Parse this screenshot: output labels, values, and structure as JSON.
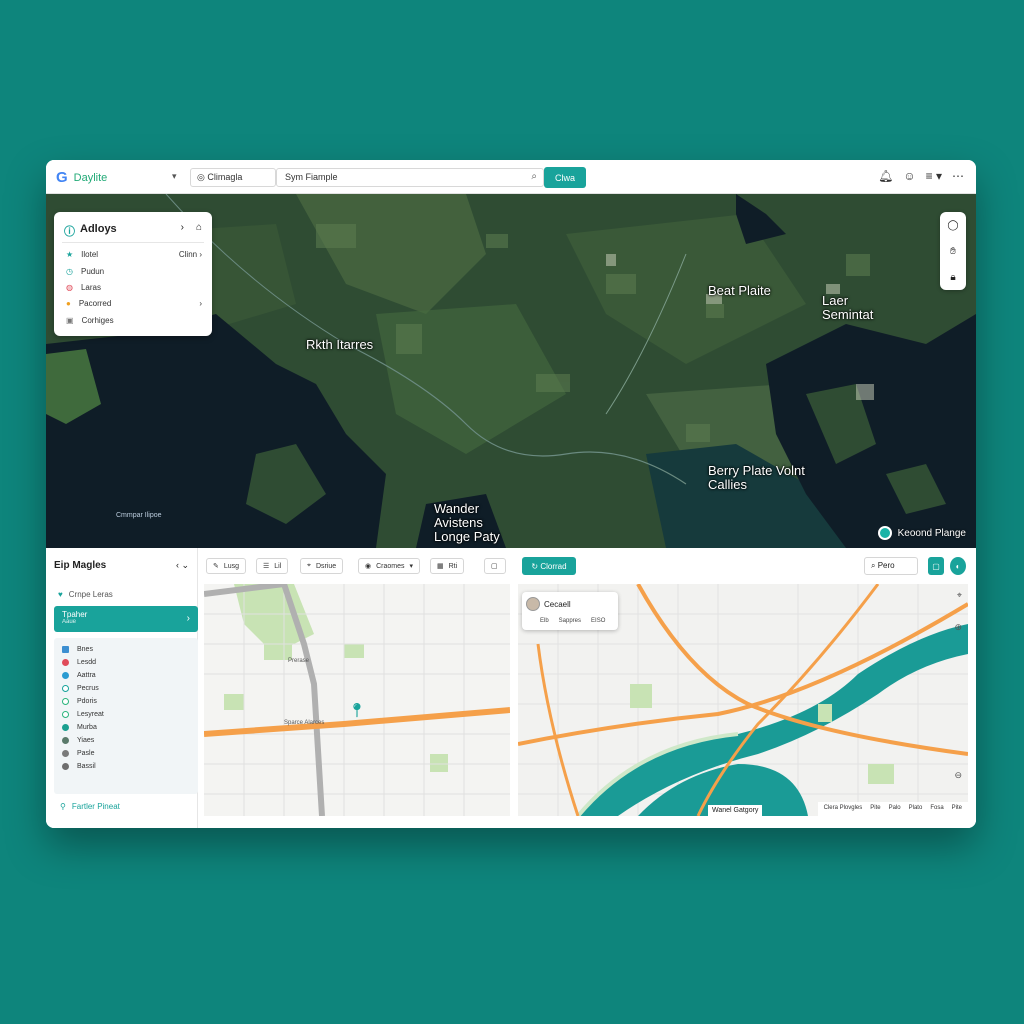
{
  "topbar": {
    "logo": "G",
    "brand": "Daylite",
    "location": "Climagla",
    "search_value": "Sym Fiample",
    "go_label": "Clwa",
    "icons": [
      "bell-icon",
      "user-icon",
      "menu-icon"
    ]
  },
  "layers": {
    "title": "Adloys",
    "items": [
      {
        "label": "Ilotel",
        "extra": "Clinn"
      },
      {
        "label": "Pudun",
        "extra": ""
      },
      {
        "label": "Laras",
        "extra": ""
      },
      {
        "label": "Pacorred",
        "extra": ""
      },
      {
        "label": "Corhiges",
        "extra": ""
      }
    ]
  },
  "satellite": {
    "labels": {
      "kith": "Rkth Itarres",
      "beat": "Beat Plaite",
      "laer": "Laer\nSemintat",
      "bern": "Berry Plate Volnt\nCallies",
      "wander": "Wander\nAvistens\nLonge Paty"
    },
    "legend": "Keoond Plange",
    "small": "Cmmpar Ilipoe"
  },
  "sidebar": {
    "title": "Eip Magles",
    "subtitle": "Crnpe Leras",
    "active_title": "Tpaher",
    "active_sub": "Aaue",
    "items": [
      {
        "label": "Bnes",
        "color": "#3d8fd1"
      },
      {
        "label": "Lesdd",
        "color": "#e04b5a"
      },
      {
        "label": "Aattra",
        "color": "#2a9bd1"
      },
      {
        "label": "Pecrus",
        "color": "#17a39b"
      },
      {
        "label": "Pdoris",
        "color": "#2ab47c"
      },
      {
        "label": "Lesyreat",
        "color": "#2ab47c"
      },
      {
        "label": "Murba",
        "color": "#1a9f8f"
      },
      {
        "label": "Yiaes",
        "color": "#5a7a6a"
      },
      {
        "label": "Pasle",
        "color": "#7a7a7a"
      },
      {
        "label": "Bassil",
        "color": "#6e6e6e"
      }
    ],
    "footer": "Fartler Pineat"
  },
  "toolbar": {
    "btn1": "Lusg",
    "btn2": "Lil",
    "btn3": "Dsriue",
    "btn4": "Craomes",
    "btn5": "Rti",
    "primary": "Clorrad",
    "search": "Pero"
  },
  "map1": {
    "road_label": "Sparce Alarces",
    "park_label": "Prerase"
  },
  "map2": {
    "card_title": "Cecaell",
    "card_row": [
      "Elb",
      "Sappres",
      "EISO"
    ],
    "caption": "Wanel Gatgory",
    "legend": [
      "Clera Plovgles",
      "Pite",
      "Palo",
      "Plato",
      "Fosa",
      "Pite"
    ]
  }
}
